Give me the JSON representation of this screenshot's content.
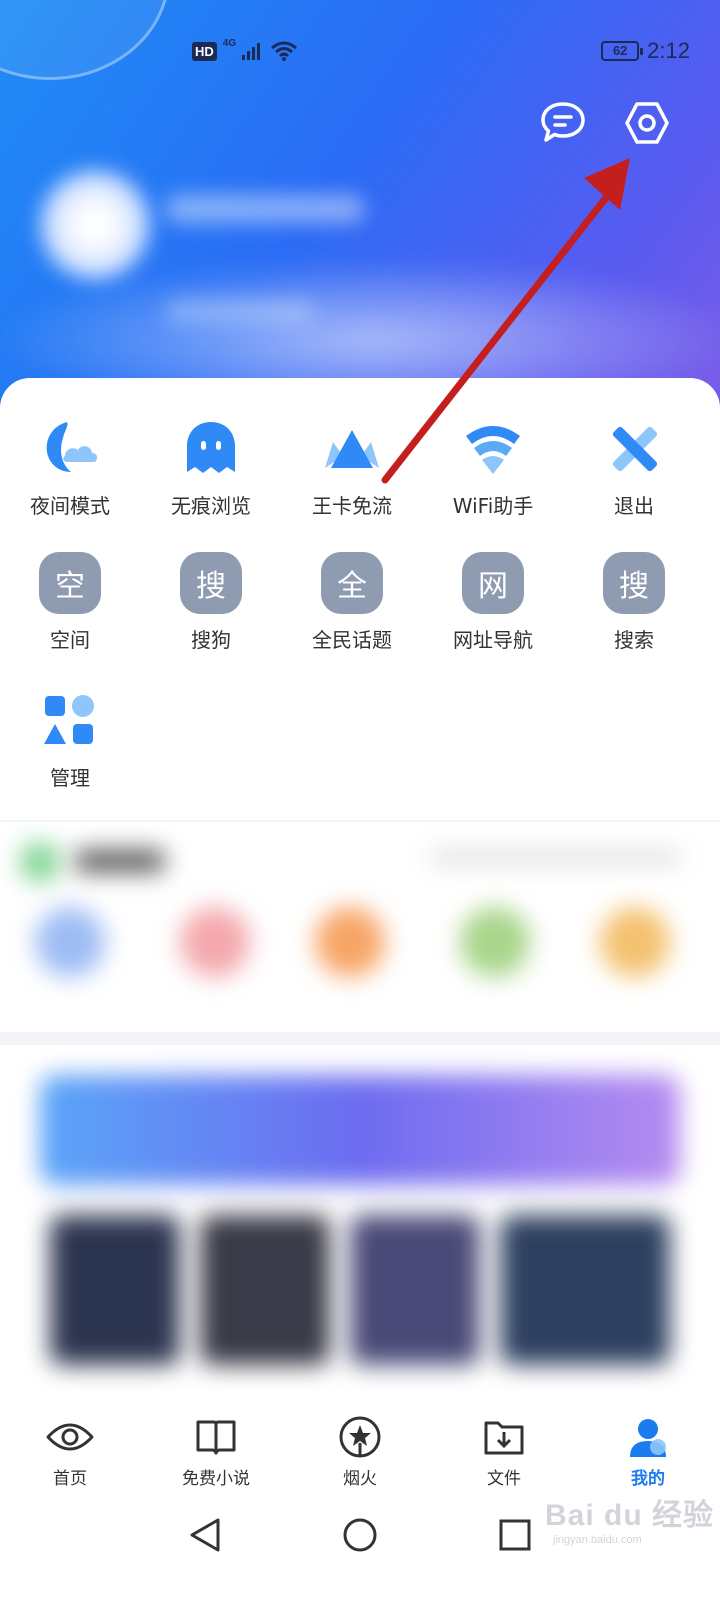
{
  "status_bar": {
    "hd": "HD",
    "network": "4G",
    "battery": "62",
    "time": "2:12"
  },
  "header": {
    "message_icon": "chat-bubble-icon",
    "settings_icon": "hexagon-gear-icon"
  },
  "tools": [
    {
      "label": "夜间模式",
      "icon": "moon-cloud-icon",
      "color": "#2f8af5"
    },
    {
      "label": "无痕浏览",
      "icon": "ghost-icon",
      "color": "#2f8af5"
    },
    {
      "label": "王卡免流",
      "icon": "crown-icon",
      "color": "#2f8af5"
    },
    {
      "label": "WiFi助手",
      "icon": "wifi-icon",
      "color": "#2f8af5"
    },
    {
      "label": "退出",
      "icon": "exit-x-icon",
      "color": "#2f8af5"
    },
    {
      "label": "空间",
      "char": "空"
    },
    {
      "label": "搜狗",
      "char": "搜"
    },
    {
      "label": "全民话题",
      "char": "全"
    },
    {
      "label": "网址导航",
      "char": "网"
    },
    {
      "label": "搜索",
      "char": "搜"
    },
    {
      "label": "管理",
      "icon": "shapes-grid-icon",
      "color": "#2f8af5"
    }
  ],
  "bottom_nav": [
    {
      "label": "首页",
      "icon": "eye-icon",
      "active": false
    },
    {
      "label": "免费小说",
      "icon": "book-icon",
      "active": false
    },
    {
      "label": "烟火",
      "icon": "firework-icon",
      "active": false
    },
    {
      "label": "文件",
      "icon": "folder-download-icon",
      "active": false
    },
    {
      "label": "我的",
      "icon": "person-icon",
      "active": true
    }
  ],
  "system_nav": [
    "back-triangle-icon",
    "home-circle-icon",
    "recents-square-icon"
  ],
  "watermark": {
    "main": "Bai du 经验",
    "sub": "jingyan.baidu.com"
  },
  "colors": {
    "accent": "#1a7cf0",
    "annotation_arrow": "#c41e1e",
    "char_tile": "#8e9bb0"
  }
}
